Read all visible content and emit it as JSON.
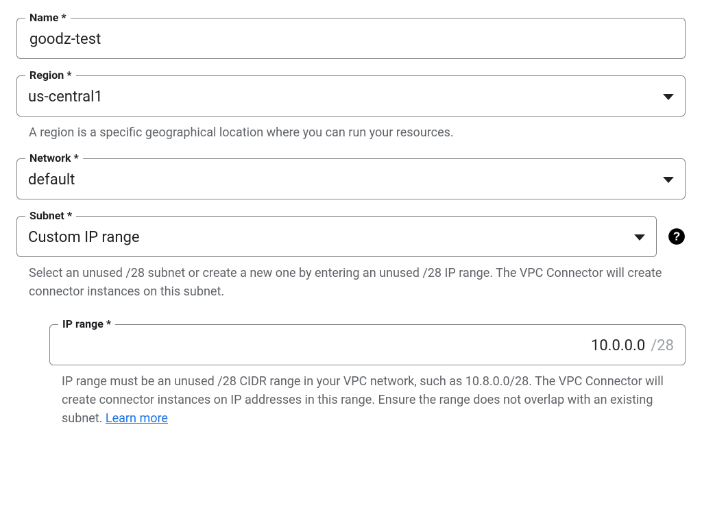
{
  "name": {
    "label": "Name",
    "required_marker": "*",
    "value": "goodz-test"
  },
  "region": {
    "label": "Region",
    "required_marker": "*",
    "value": "us-central1",
    "helper": "A region is a specific geographical location where you can run your resources."
  },
  "network": {
    "label": "Network",
    "required_marker": "*",
    "value": "default"
  },
  "subnet": {
    "label": "Subnet",
    "required_marker": "*",
    "value": "Custom IP range",
    "helper": "Select an unused /28 subnet or create a new one by entering an unused /28 IP range. The VPC Connector will create connector instances on this subnet."
  },
  "ip_range": {
    "label": "IP range",
    "required_marker": "*",
    "value": "10.0.0.0",
    "suffix": "/28",
    "helper_text": "IP range must be an unused /28 CIDR range in your VPC network, such as 10.8.0.0/28. The VPC Connector will create connector instances on IP addresses in this range. Ensure the range does not overlap with an existing subnet. ",
    "learn_more_label": "Learn more"
  }
}
